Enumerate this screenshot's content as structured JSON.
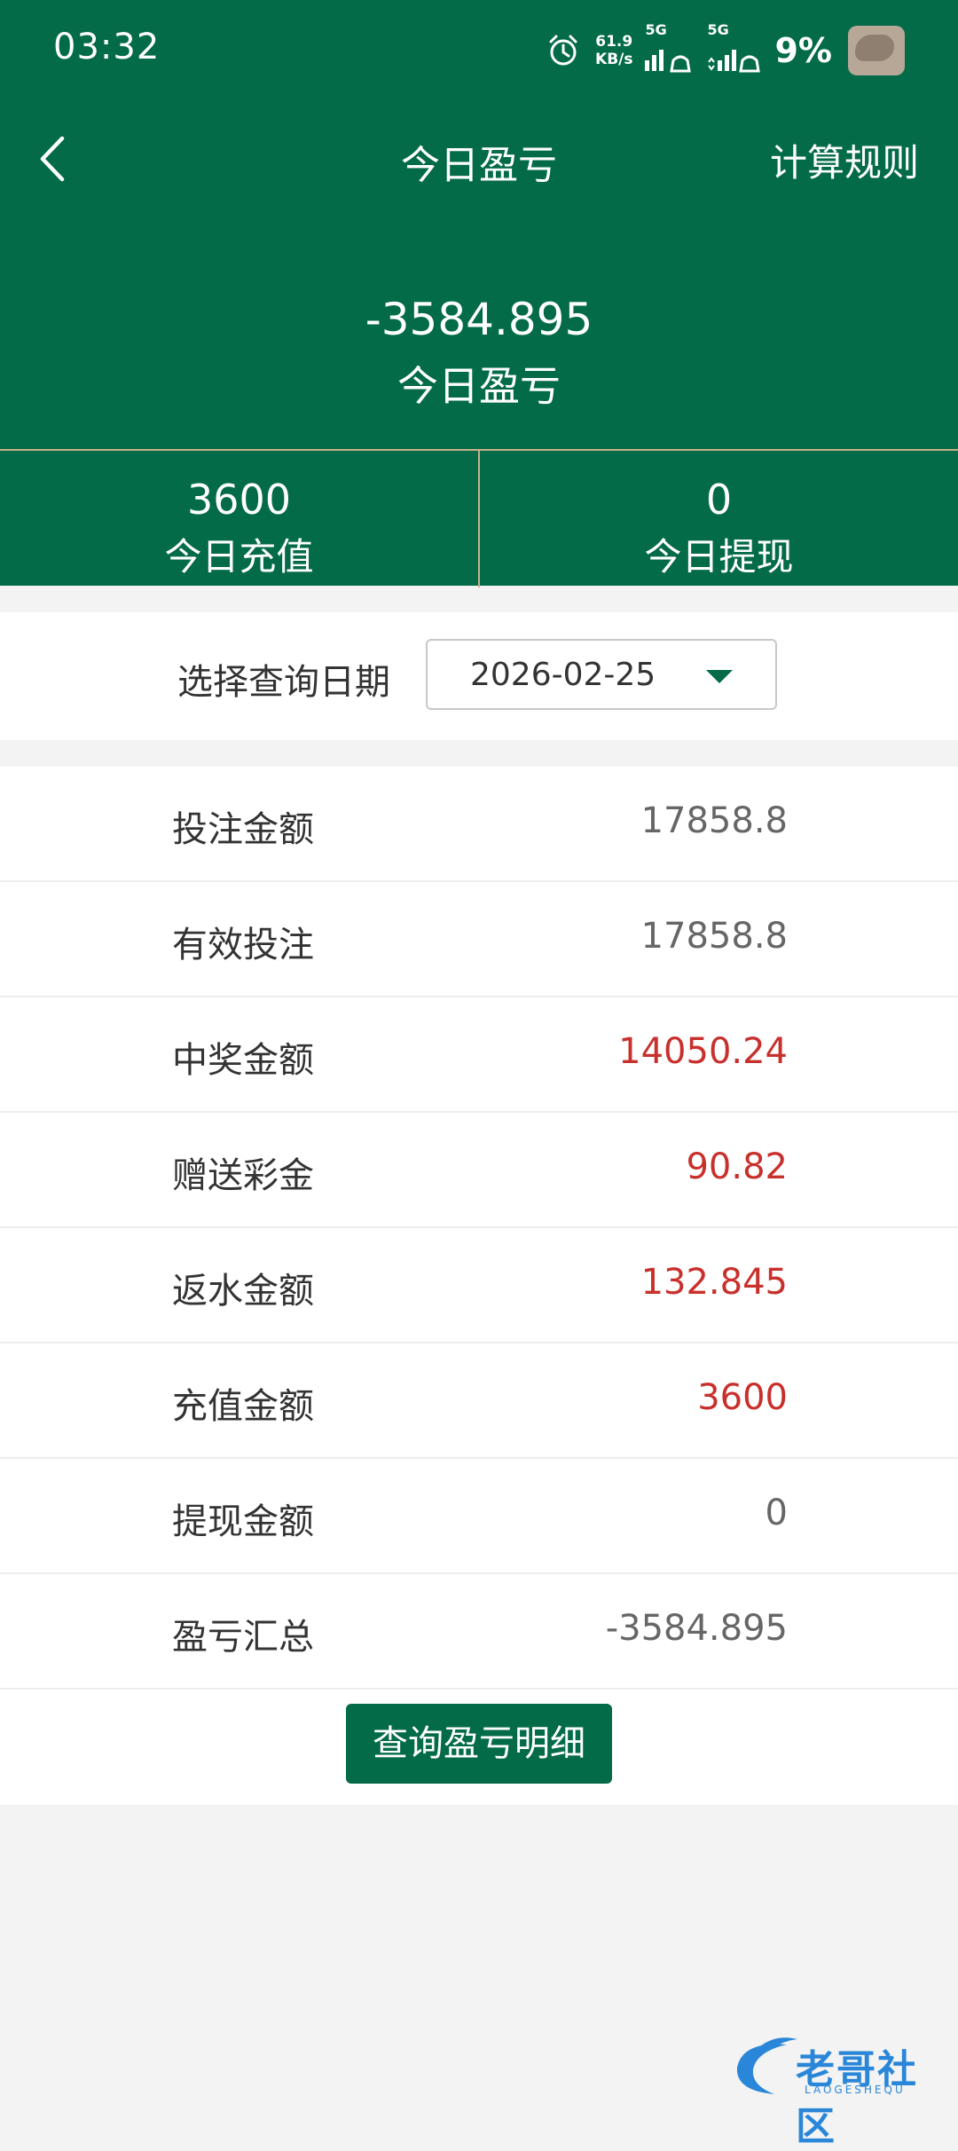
{
  "status_bar": {
    "time": "03:32",
    "net_speed_value": "61.9",
    "net_speed_unit": "KB/s",
    "sim1": "5G",
    "sim2": "5G",
    "battery": "9%",
    "icons": [
      "alarm-icon",
      "signal-icon",
      "signal-icon",
      "avatar"
    ]
  },
  "nav": {
    "title": "今日盈亏",
    "rules_link": "计算规则",
    "back_icon": "chevron-left-icon"
  },
  "summary": {
    "value": "-3584.895",
    "label": "今日盈亏"
  },
  "stats": [
    {
      "value": "3600",
      "label": "今日充值"
    },
    {
      "value": "0",
      "label": "今日提现"
    }
  ],
  "date_filter": {
    "label": "选择查询日期",
    "selected": "2026-02-25"
  },
  "rows": [
    {
      "label": "投注金额",
      "value": "17858.8",
      "highlight": false
    },
    {
      "label": "有效投注",
      "value": "17858.8",
      "highlight": false
    },
    {
      "label": "中奖金额",
      "value": "14050.24",
      "highlight": true
    },
    {
      "label": "赠送彩金",
      "value": "90.82",
      "highlight": true
    },
    {
      "label": "返水金额",
      "value": "132.845",
      "highlight": true
    },
    {
      "label": "充值金额",
      "value": "3600",
      "highlight": true
    },
    {
      "label": "提现金额",
      "value": "0",
      "highlight": false
    },
    {
      "label": "盈亏汇总",
      "value": "-3584.895",
      "highlight": false
    }
  ],
  "detail_button": "查询盈亏明细",
  "watermark": {
    "text": "老哥社区",
    "sub": "LAOGESHEQU"
  },
  "colors": {
    "brand_green": "#036b47",
    "highlight_red": "#c8302c",
    "divider_gold": "#c8b08a"
  }
}
